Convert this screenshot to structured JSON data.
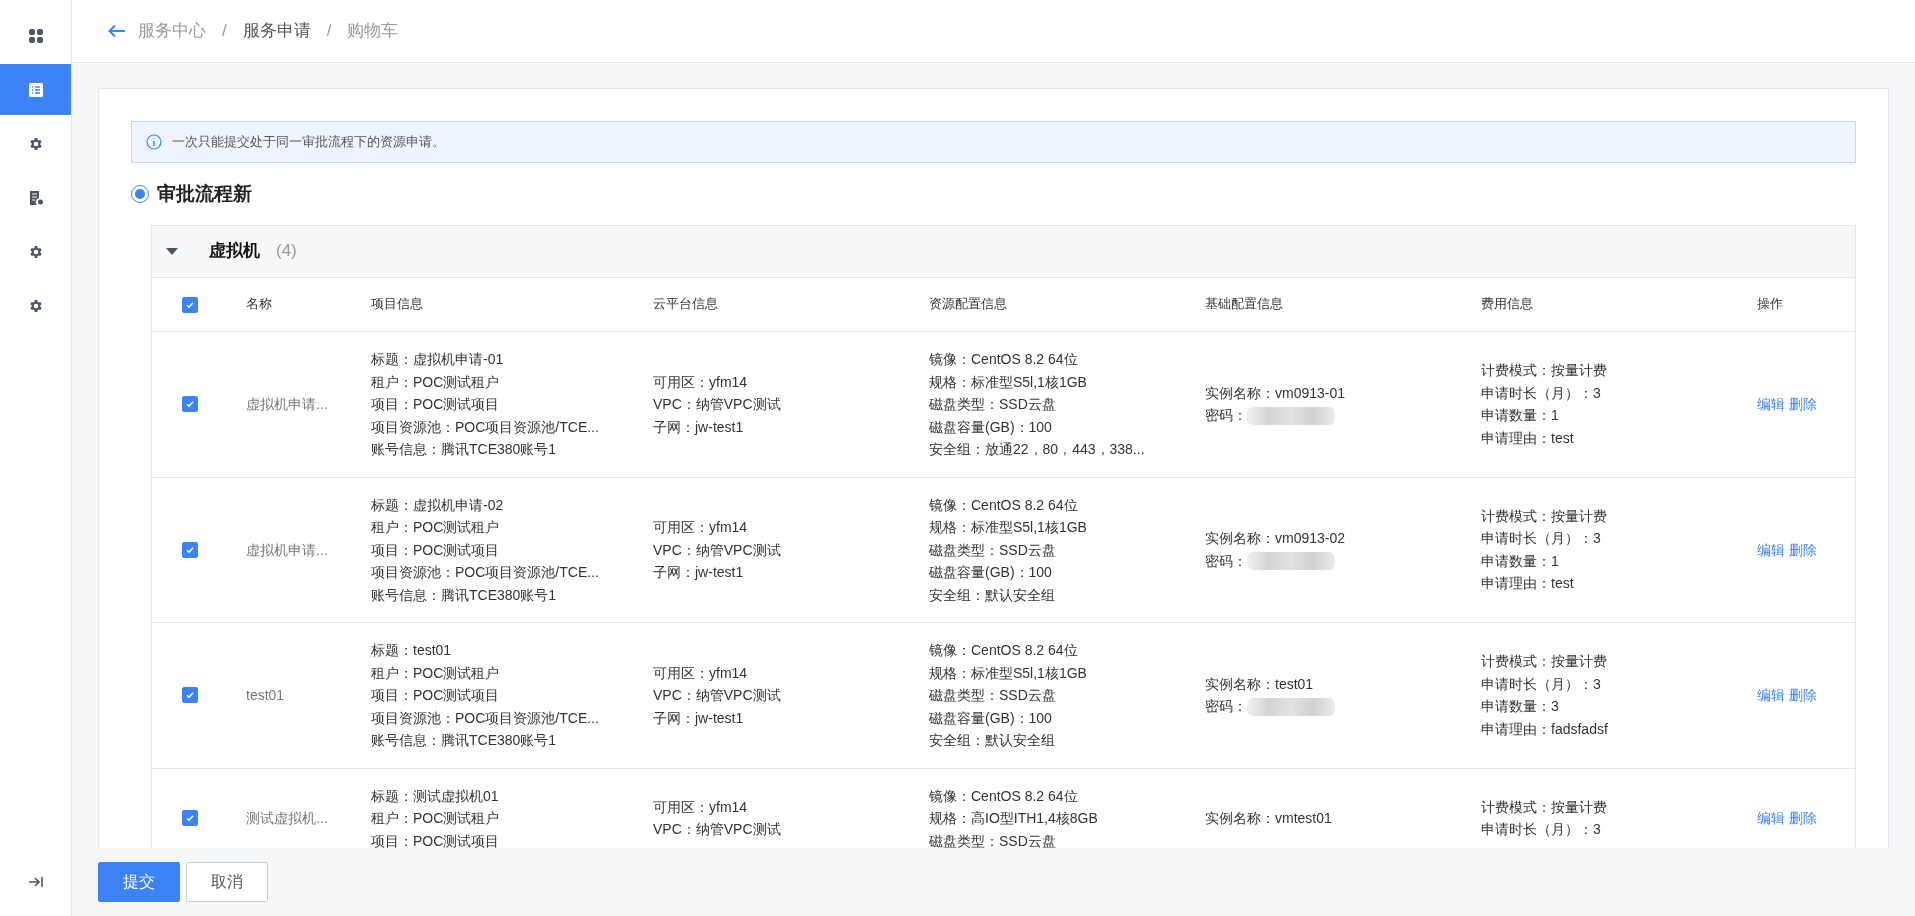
{
  "sidebar": {
    "items": [
      {
        "selected": false
      },
      {
        "selected": true
      },
      {
        "selected": false
      },
      {
        "selected": false
      },
      {
        "selected": false
      },
      {
        "selected": false
      }
    ]
  },
  "breadcrumb": [
    {
      "label": "服务中心"
    },
    {
      "separator": "/",
      "label": "服务申请"
    },
    {
      "separator": "/",
      "label": "购物车"
    }
  ],
  "alert": "一次只能提交处于同一审批流程下的资源申请。",
  "workflow": {
    "label": "审批流程新",
    "selected": true
  },
  "group": {
    "title": "虚拟机",
    "count": "(4)",
    "expanded": true
  },
  "table": {
    "all_checked": true,
    "columns": [
      "名称",
      "项目信息",
      "云平台信息",
      "资源配置信息",
      "基础配置信息",
      "费用信息",
      "操作"
    ],
    "rows": [
      {
        "checked": true,
        "name": "虚拟机申请...",
        "project_info": [
          "标题：虚拟机申请-01",
          "租户：POC测试租户",
          "项目：POC测试项目",
          "项目资源池：POC项目资源池/TCE...",
          "账号信息：腾讯TCE380账号1"
        ],
        "cloud_info": [
          "可用区：yfm14",
          "VPC：纳管VPC测试",
          "子网：jw-test1"
        ],
        "resource_info": [
          "镜像：CentOS 8.2 64位",
          "规格：标准型S5l,1核1GB",
          "磁盘类型：SSD云盘",
          "磁盘容量(GB)：100",
          "安全组：放通22，80，443，338..."
        ],
        "basic_info": [
          {
            "kind": "text",
            "text": "实例名称：vm0913-01"
          },
          {
            "kind": "masked",
            "text": "密码："
          }
        ],
        "fee_info": [
          "计费模式：按量计费",
          "申请时长（月）：3",
          "申请数量：1",
          "申请理由：test"
        ],
        "actions": [
          "编辑",
          "删除"
        ]
      },
      {
        "checked": true,
        "name": "虚拟机申请...",
        "project_info": [
          "标题：虚拟机申请-02",
          "租户：POC测试租户",
          "项目：POC测试项目",
          "项目资源池：POC项目资源池/TCE...",
          "账号信息：腾讯TCE380账号1"
        ],
        "cloud_info": [
          "可用区：yfm14",
          "VPC：纳管VPC测试",
          "子网：jw-test1"
        ],
        "resource_info": [
          "镜像：CentOS 8.2 64位",
          "规格：标准型S5l,1核1GB",
          "磁盘类型：SSD云盘",
          "磁盘容量(GB)：100",
          "安全组：默认安全组"
        ],
        "basic_info": [
          {
            "kind": "text",
            "text": "实例名称：vm0913-02"
          },
          {
            "kind": "masked",
            "text": "密码："
          }
        ],
        "fee_info": [
          "计费模式：按量计费",
          "申请时长（月）：3",
          "申请数量：1",
          "申请理由：test"
        ],
        "actions": [
          "编辑",
          "删除"
        ]
      },
      {
        "checked": true,
        "name": "test01",
        "project_info": [
          "标题：test01",
          "租户：POC测试租户",
          "项目：POC测试项目",
          "项目资源池：POC项目资源池/TCE...",
          "账号信息：腾讯TCE380账号1"
        ],
        "cloud_info": [
          "可用区：yfm14",
          "VPC：纳管VPC测试",
          "子网：jw-test1"
        ],
        "resource_info": [
          "镜像：CentOS 8.2 64位",
          "规格：标准型S5l,1核1GB",
          "磁盘类型：SSD云盘",
          "磁盘容量(GB)：100",
          "安全组：默认安全组"
        ],
        "basic_info": [
          {
            "kind": "text",
            "text": "实例名称：test01"
          },
          {
            "kind": "masked",
            "text": "密码："
          }
        ],
        "fee_info": [
          "计费模式：按量计费",
          "申请时长（月）：3",
          "申请数量：3",
          "申请理由：fadsfadsf"
        ],
        "actions": [
          "编辑",
          "删除"
        ]
      },
      {
        "checked": true,
        "name": "测试虚拟机...",
        "project_info": [
          "标题：测试虚拟机01",
          "租户：POC测试租户",
          "项目：POC测试项目"
        ],
        "cloud_info": [
          "可用区：yfm14",
          "VPC：纳管VPC测试"
        ],
        "resource_info": [
          "镜像：CentOS 8.2 64位",
          "规格：高IO型ITH1,4核8GB",
          "磁盘类型：SSD云盘"
        ],
        "basic_info": [
          {
            "kind": "text",
            "text": "实例名称：vmtest01"
          }
        ],
        "fee_info": [
          "计费模式：按量计费",
          "申请时长（月）：3"
        ],
        "actions": [
          "编辑",
          "删除"
        ]
      }
    ]
  },
  "footer": {
    "buttons": [
      {
        "label": "提交",
        "kind": "primary"
      },
      {
        "label": "取消",
        "kind": "default"
      }
    ]
  }
}
